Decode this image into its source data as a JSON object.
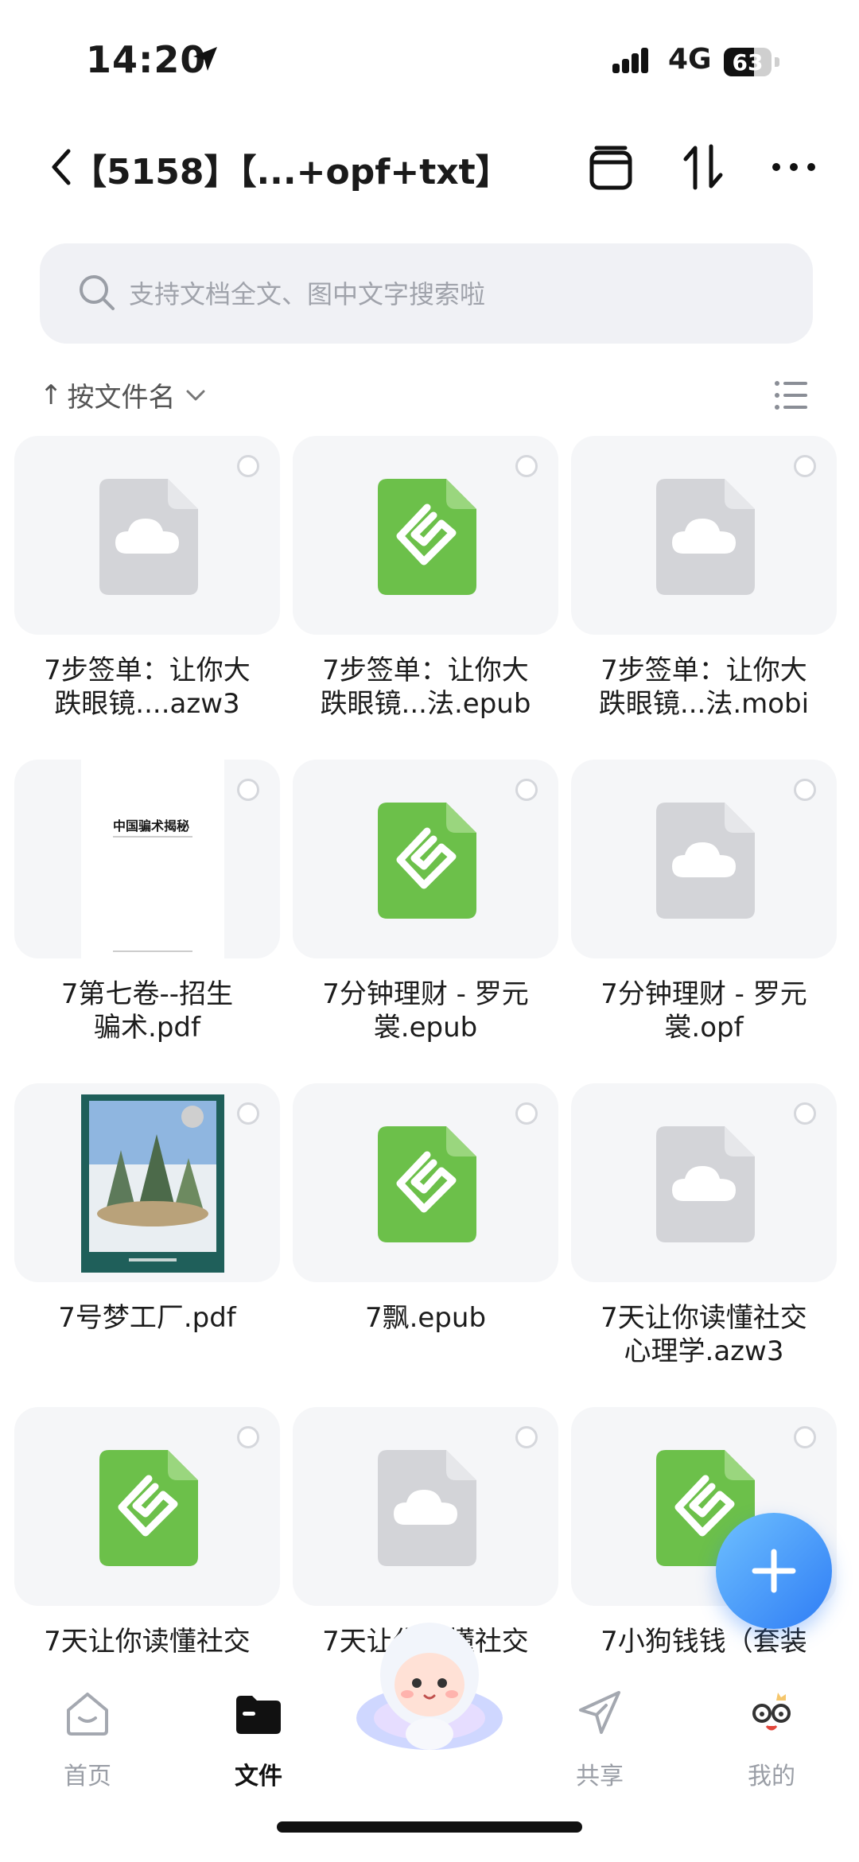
{
  "status_bar": {
    "time": "14:20",
    "network": "4G",
    "battery": "63",
    "battery_level": 0.63
  },
  "header": {
    "title": "【5158】【...+opf+txt】"
  },
  "search": {
    "placeholder": "支持文档全文、图中文字搜索啦"
  },
  "sort": {
    "label": "按文件名"
  },
  "pdf_thumb_title": "中国骗术揭秘",
  "files": [
    {
      "name_line1": "7步签单：让你大",
      "name_line2": "跌眼镜....azw3",
      "icon": "cloud-file-icon"
    },
    {
      "name_line1": "7步签单：让你大",
      "name_line2": "跌眼镜...法.epub",
      "icon": "epub-file-icon"
    },
    {
      "name_line1": "7步签单：让你大",
      "name_line2": "跌眼镜...法.mobi",
      "icon": "cloud-file-icon"
    },
    {
      "name_line1": "7第七卷--招生",
      "name_line2": "骗术.pdf",
      "icon": "pdf-thumbnail"
    },
    {
      "name_line1": "7分钟理财 - 罗元",
      "name_line2": "裳.epub",
      "icon": "epub-file-icon"
    },
    {
      "name_line1": "7分钟理财 - 罗元",
      "name_line2": "裳.opf",
      "icon": "cloud-file-icon"
    },
    {
      "name_line1": "7号梦工厂.pdf",
      "name_line2": "",
      "icon": "cover-thumbnail"
    },
    {
      "name_line1": "7飘.epub",
      "name_line2": "",
      "icon": "epub-file-icon"
    },
    {
      "name_line1": "7天让你读懂社交",
      "name_line2": "心理学.azw3",
      "icon": "cloud-file-icon"
    },
    {
      "name_line1": "7天让你读懂社交",
      "name_line2": "",
      "icon": "epub-file-icon"
    },
    {
      "name_line1": "7天让你读懂社交",
      "name_line2": "",
      "icon": "cloud-file-icon"
    },
    {
      "name_line1": "7小狗钱钱（套装",
      "name_line2": "",
      "icon": "epub-file-icon"
    }
  ],
  "nav": {
    "home": "首页",
    "files": "文件",
    "share": "共享",
    "me": "我的"
  },
  "colors": {
    "epub_green": "#6cc04a",
    "cloud_gray": "#d3d4d8",
    "accent_blue": "#2f7df5"
  }
}
